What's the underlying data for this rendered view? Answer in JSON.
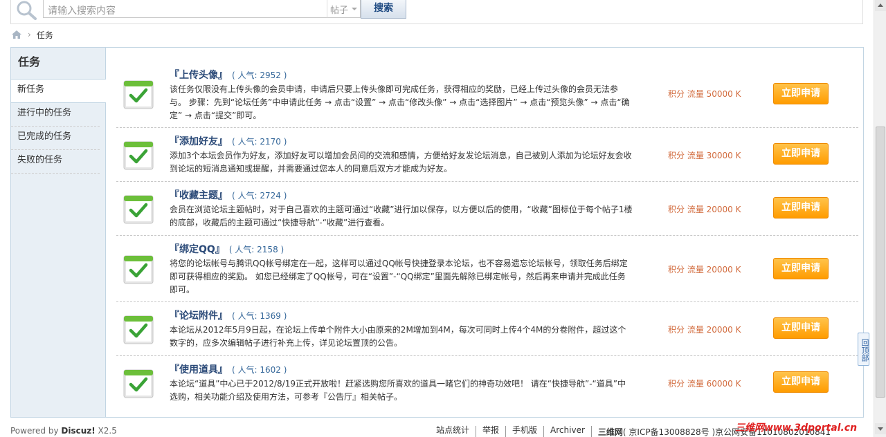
{
  "search": {
    "placeholder": "请输入搜索内容",
    "type_label": "帖子",
    "button_label": "搜索"
  },
  "breadcrumb": {
    "current": "任务"
  },
  "sidebar": {
    "title": "任务",
    "items": [
      {
        "label": "新任务",
        "active": true
      },
      {
        "label": "进行中的任务",
        "active": false
      },
      {
        "label": "已完成的任务",
        "active": false
      },
      {
        "label": "失败的任务",
        "active": false
      }
    ]
  },
  "tasks": [
    {
      "title": "『上传头像』",
      "popularity": "( 人气: 2952 )",
      "desc": "该任务仅限没有上传头像的会员申请，申请后只要上传头像即可完成任务，获得相应的奖励，已经上传过头像的会员无法参与。 步骤：先到“论坛任务”中申请此任务 → 点击“设置” → 点击“修改头像” → 点击“选择图片” → 点击“预览头像” → 点击“确定” → 点击“提交”即可。",
      "reward": "积分 流量 50000 K",
      "button": "立即申请"
    },
    {
      "title": "『添加好友』",
      "popularity": "( 人气: 2170 )",
      "desc": "添加3个本坛会员作为好友，添加好友可以增加会员间的交流和感情，方便给好友发论坛消息，自己被别人添加为论坛好友会收到论坛的短消息通知或提醒，并需要通过您本人的同意后双方才能成为好友。",
      "reward": "积分 流量 30000 K",
      "button": "立即申请"
    },
    {
      "title": "『收藏主题』",
      "popularity": "( 人气: 2724 )",
      "desc": "会员在浏览论坛主题帖时，对于自己喜欢的主题可通过“收藏”进行加以保存，以方便以后的使用，“收藏”图标位于每个帖子1楼的底部，收藏后的主题可通过“快捷导航”-“收藏”进行查看。",
      "reward": "积分 流量 20000 K",
      "button": "立即申请"
    },
    {
      "title": "『绑定QQ』",
      "popularity": "( 人气: 2158 )",
      "desc": "将您的论坛帐号与腾讯QQ帐号绑定在一起，这样可以通过QQ帐号快捷登录本论坛，也不容易遗忘论坛帐号，领取任务后绑定即可获得相应的奖励。 如您已经绑定了QQ帐号，可在“设置”-“QQ绑定”里面先解除已绑定帐号，然后再来申请并完成此任务即可。",
      "reward": "积分 流量 20000 K",
      "button": "立即申请"
    },
    {
      "title": "『论坛附件』",
      "popularity": "( 人气: 1369 )",
      "desc": "本论坛从2012年5月9日起，在论坛上传单个附件大小由原来的2M增加到4M，每次可同时上传4个4M的分卷附件，超过这个数字的，应多次编辑帖子进行补充上传，详见论坛置顶的公告。",
      "reward": "积分 流量 20000 K",
      "button": "立即申请"
    },
    {
      "title": "『使用道具』",
      "popularity": "( 人气: 1602 )",
      "desc": "本论坛“道具”中心已于2012/8/19正式开放啦！赶紧选购您所喜欢的道具一睹它们的神奇功效吧！ 请在“快捷导航”-“道具”中选购，相关功能介绍及使用方法，可参考『公告厅』相关帖子。",
      "reward": "积分 流量 60000 K",
      "button": "立即申请"
    }
  ],
  "back_to_top": "回顶部",
  "footer": {
    "powered_prefix": "Powered by ",
    "powered_brand": "Discuz!",
    "powered_version": " X2.5",
    "links": [
      "站点统计",
      "举报",
      "手机版",
      "Archiver"
    ],
    "site_name": "三维网",
    "icp": "( 京ICP备13008828号 )京公网安备11010802010841",
    "watermark": "三维网www.3dportal.cn"
  },
  "colors": {
    "accent": "#2b4a78",
    "reward": "#d26b3d",
    "button": "#ff9c00",
    "sidebar_bg": "#e8eff5"
  }
}
